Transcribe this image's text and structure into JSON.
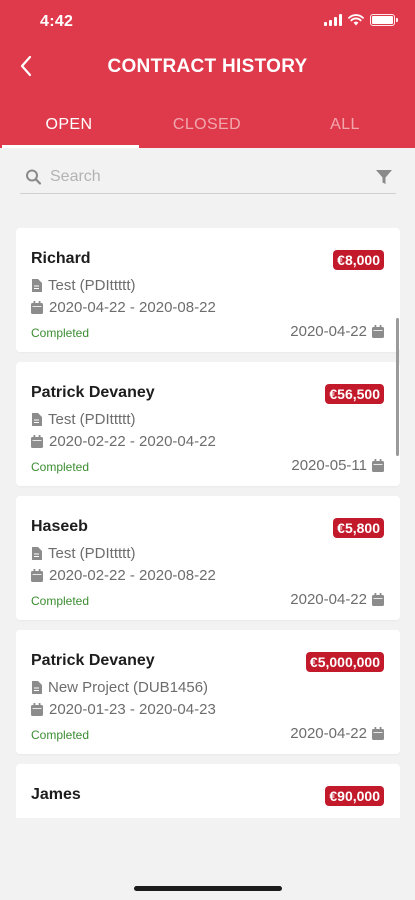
{
  "status_bar": {
    "time": "4:42"
  },
  "header": {
    "title": "CONTRACT HISTORY"
  },
  "tabs": [
    {
      "label": "OPEN",
      "active": true
    },
    {
      "label": "CLOSED",
      "active": false
    },
    {
      "label": "ALL",
      "active": false
    }
  ],
  "search": {
    "placeholder": "Search",
    "value": ""
  },
  "contracts": [
    {
      "name": "Richard",
      "amount": "€8,000",
      "project": "Test (PDIttttt)",
      "period": "2020-04-22 - 2020-08-22",
      "status": "Completed",
      "date": "2020-04-22"
    },
    {
      "name": "Patrick Devaney",
      "amount": "€56,500",
      "project": "Test (PDIttttt)",
      "period": "2020-02-22 - 2020-04-22",
      "status": "Completed",
      "date": "2020-05-11"
    },
    {
      "name": "Haseeb",
      "amount": "€5,800",
      "project": "Test (PDIttttt)",
      "period": "2020-02-22 - 2020-08-22",
      "status": "Completed",
      "date": "2020-04-22"
    },
    {
      "name": "Patrick Devaney",
      "amount": "€5,000,000",
      "project": "New Project (DUB1456)",
      "period": "2020-01-23 - 2020-04-23",
      "status": "Completed",
      "date": "2020-04-22"
    },
    {
      "name": "James",
      "amount": "€90,000",
      "project": "",
      "period": "",
      "status": "",
      "date": ""
    }
  ],
  "colors": {
    "header": "#df3a4b",
    "amount_badge": "#c21a2b",
    "status_completed": "#3c8d32",
    "background": "#f2f2f2"
  },
  "icons": [
    "back-arrow-icon",
    "search-icon",
    "filter-icon",
    "document-icon",
    "calendar-icon",
    "wifi-icon",
    "battery-icon",
    "signal-icon"
  ]
}
